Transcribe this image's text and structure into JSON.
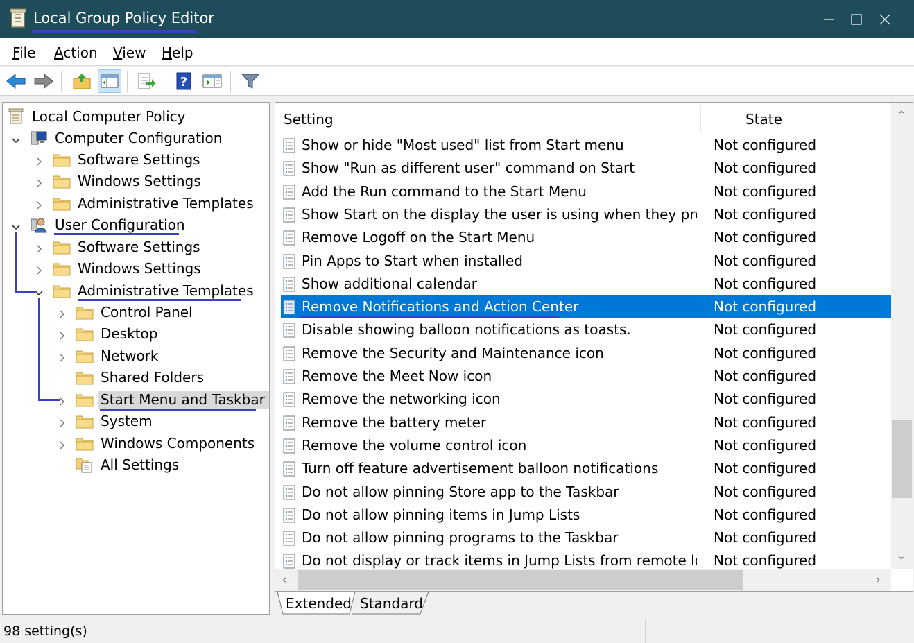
{
  "window": {
    "title": "Local Group Policy Editor",
    "colors": {
      "titlebar": "#1e4c5a",
      "selection": "#0078d7",
      "annotation": "#3a3ec8"
    }
  },
  "menu": {
    "file": {
      "accel": "F",
      "rest": "ile"
    },
    "action": {
      "accel": "A",
      "rest": "ction"
    },
    "view": {
      "accel": "V",
      "rest": "iew"
    },
    "help": {
      "accel": "H",
      "rest": "elp"
    }
  },
  "toolbar": [
    "back-arrow-icon",
    "forward-arrow-icon",
    "up-folder-icon",
    "show-hide-tree-icon",
    "export-list-icon",
    "help-icon",
    "properties-pane-icon",
    "filter-icon"
  ],
  "tree": {
    "root": "Local Computer Policy",
    "computer_config": "Computer Configuration",
    "cc_software": "Software Settings",
    "cc_windows": "Windows Settings",
    "cc_admin": "Administrative Templates",
    "user_config": "User Configuration",
    "uc_software": "Software Settings",
    "uc_windows": "Windows Settings",
    "uc_admin": "Administrative Templates",
    "control_panel": "Control Panel",
    "desktop": "Desktop",
    "network": "Network",
    "shared_folders": "Shared Folders",
    "start_menu": "Start Menu and Taskbar",
    "system": "System",
    "windows_components": "Windows Components",
    "all_settings": "All Settings"
  },
  "list": {
    "columns": {
      "setting": "Setting",
      "state": "State"
    },
    "rows": [
      {
        "setting": "Show or hide \"Most used\" list from Start menu",
        "state": "Not configured"
      },
      {
        "setting": "Show \"Run as different user\" command on Start",
        "state": "Not configured"
      },
      {
        "setting": "Add the Run command to the Start Menu",
        "state": "Not configured"
      },
      {
        "setting": "Show Start on the display the user is using when they press t...",
        "state": "Not configured"
      },
      {
        "setting": "Remove Logoff on the Start Menu",
        "state": "Not configured"
      },
      {
        "setting": "Pin Apps to Start when installed",
        "state": "Not configured"
      },
      {
        "setting": "Show additional calendar",
        "state": "Not configured"
      },
      {
        "setting": "Remove Notifications and Action Center",
        "state": "Not configured",
        "selected": true
      },
      {
        "setting": "Disable showing balloon notifications as toasts.",
        "state": "Not configured"
      },
      {
        "setting": "Remove the Security and Maintenance icon",
        "state": "Not configured"
      },
      {
        "setting": "Remove the Meet Now icon",
        "state": "Not configured"
      },
      {
        "setting": "Remove the networking icon",
        "state": "Not configured"
      },
      {
        "setting": "Remove the battery meter",
        "state": "Not configured"
      },
      {
        "setting": "Remove the volume control icon",
        "state": "Not configured"
      },
      {
        "setting": "Turn off feature advertisement balloon notifications",
        "state": "Not configured"
      },
      {
        "setting": "Do not allow pinning Store app to the Taskbar",
        "state": "Not configured"
      },
      {
        "setting": "Do not allow pinning items in Jump Lists",
        "state": "Not configured"
      },
      {
        "setting": "Do not allow pinning programs to the Taskbar",
        "state": "Not configured"
      },
      {
        "setting": "Do not display or track items in Jump Lists from remote locati...",
        "state": "Not configured"
      }
    ]
  },
  "tabs": {
    "extended": "Extended",
    "standard": "Standard"
  },
  "status": {
    "text": "98 setting(s)"
  }
}
